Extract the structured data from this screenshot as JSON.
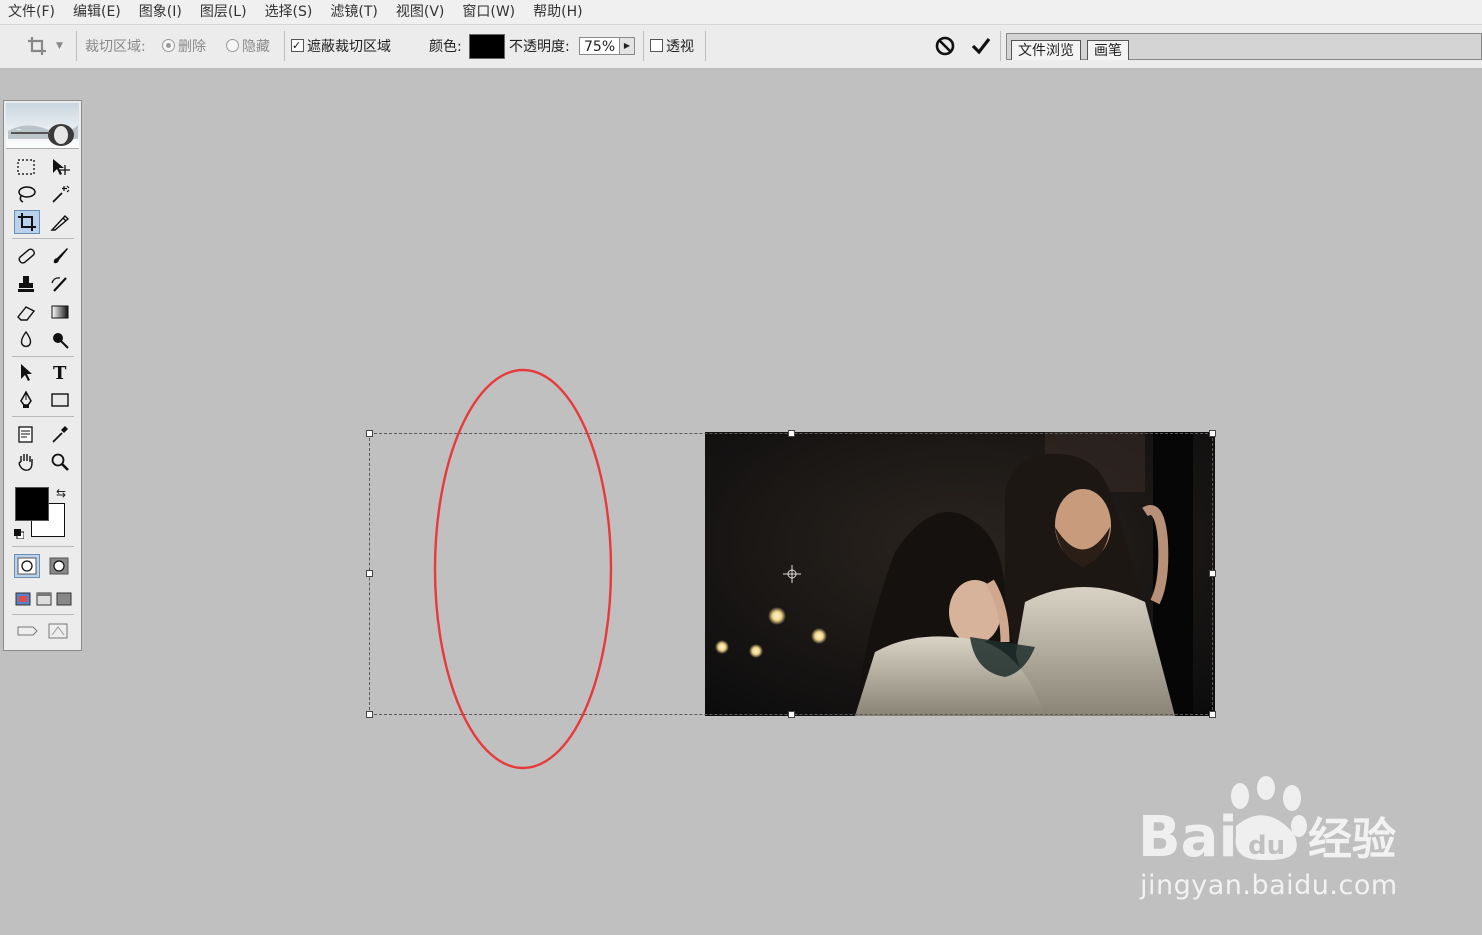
{
  "menu": [
    "文件(F)",
    "编辑(E)",
    "图象(I)",
    "图层(L)",
    "选择(S)",
    "滤镜(T)",
    "视图(V)",
    "窗口(W)",
    "帮助(H)"
  ],
  "options": {
    "crop_area_label": "裁切区域:",
    "delete_label": "删除",
    "hide_label": "隐藏",
    "shield_label": "遮蔽裁切区域",
    "shield_checked": true,
    "color_label": "颜色:",
    "shield_color": "#000000",
    "opacity_label": "不透明度:",
    "opacity_value": "75%",
    "perspective_label": "透视",
    "perspective_checked": false
  },
  "palette_well": {
    "tabs": [
      "文件浏览",
      "画笔"
    ]
  },
  "toolbox": {
    "foreground_color": "#000000",
    "background_color": "#ffffff",
    "active_tool": "crop-tool"
  },
  "annotation": {
    "ellipse_color": "#e8393b"
  },
  "watermark": {
    "logo_text": "Bai 经验",
    "url": "jingyan.baidu.com"
  }
}
